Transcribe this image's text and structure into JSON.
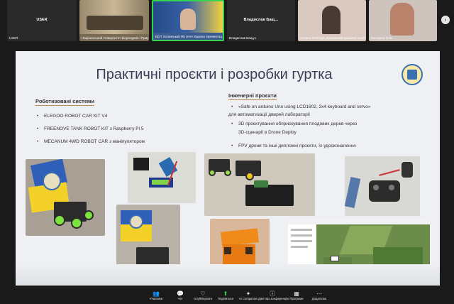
{
  "participants": [
    {
      "name": "USER",
      "caption": "USER"
    },
    {
      "name": "",
      "caption": "Національний Університет Біоресурсів і Природо…"
    },
    {
      "name": "",
      "caption": "ВСП Хотинський ФК НАН України (презентація ХЗ Т…"
    },
    {
      "name": "Владислав Бащ…",
      "caption": "Владислав Бащук"
    },
    {
      "name": "",
      "caption": "Оксана МАКОДА Державний фаховий колег…"
    },
    {
      "name": "",
      "caption": "Катерина Олег…"
    }
  ],
  "slide": {
    "title": "Практичні проєкти і розробки гуртка",
    "left_heading": "Роботизовані системи",
    "left_items": [
      "ELEGOO ROBOT CAR KIT V4",
      "FREENOVE TANK ROBOT KIT з Raspberry Pi 5",
      "MECANUM 4WD ROBOT CAR з маніпулятором"
    ],
    "right_heading": "Інженерні проєкти",
    "right_item1": "«Safe on arduino Uno using LCD1602, 3x4 keyboard and servo»",
    "right_item1_cont": "для автоматизації дверей лабораторії",
    "right_item2": "3D проєктування обприскування плодових дерев через",
    "right_item2_cont": "3D-сценарії в Drone Deploy",
    "right_item3": "FPV дрони та інші дипломні проєкти, їх удосконалення"
  },
  "toolbar": [
    {
      "icon": "participants-icon",
      "glyph": "👥",
      "label": "Учасники"
    },
    {
      "icon": "chat-icon",
      "glyph": "💬",
      "label": "Чат"
    },
    {
      "icon": "reactions-icon",
      "glyph": "♡",
      "label": "Опублікувати"
    },
    {
      "icon": "share-icon",
      "glyph": "⬆",
      "label": "Поділитися"
    },
    {
      "icon": "ai-companion-icon",
      "glyph": "✦",
      "label": "AI Companion"
    },
    {
      "icon": "info-icon",
      "glyph": "ⓘ",
      "label": "Дані про конференцію"
    },
    {
      "icon": "apps-icon",
      "glyph": "▦",
      "label": "Програми"
    },
    {
      "icon": "more-icon",
      "glyph": "⋯",
      "label": "Додатково"
    }
  ],
  "colors": {
    "active_speaker": "#39d353",
    "background": "#1a1a1a"
  }
}
